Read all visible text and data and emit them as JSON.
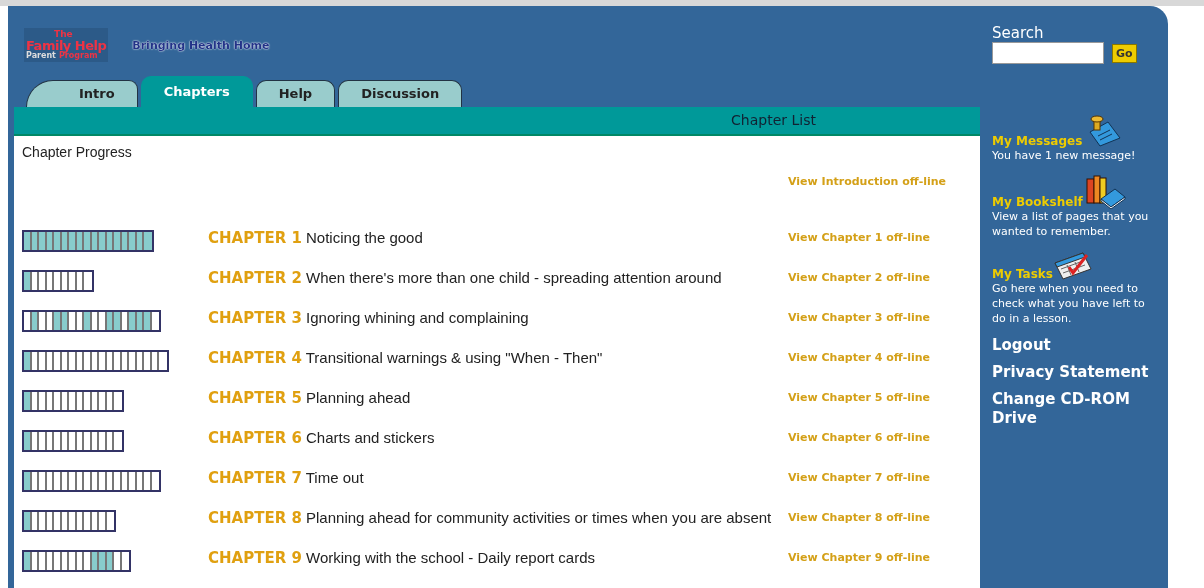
{
  "logo": {
    "top": "The",
    "main": "Family Help",
    "sub1": "Parent",
    "sub2": "Program"
  },
  "tagline": "Bringing Health Home",
  "tabs": [
    {
      "label": "Intro",
      "selected": false
    },
    {
      "label": "Chapters",
      "selected": true
    },
    {
      "label": "Help",
      "selected": false
    },
    {
      "label": "Discussion",
      "selected": false
    }
  ],
  "section_title": "Chapter List",
  "progress_heading": "Chapter Progress",
  "intro_link": "View Introduction off-line",
  "chapters": [
    {
      "number": "CHAPTER 1",
      "title": "Noticing the good",
      "link": "View Chapter 1 off-line",
      "segments": [
        true,
        true,
        true,
        true,
        true,
        true,
        true,
        true,
        true,
        true,
        true,
        true,
        true,
        true,
        true,
        true,
        true
      ]
    },
    {
      "number": "CHAPTER 2",
      "title": "When there's more than one child - spreading attention around",
      "link": "View Chapter 2 off-line",
      "segments": [
        true,
        false,
        false,
        false,
        false,
        false,
        false,
        false,
        false
      ]
    },
    {
      "number": "CHAPTER 3",
      "title": "Ignoring whining and complaining",
      "link": "View Chapter 3 off-line",
      "segments": [
        false,
        true,
        false,
        false,
        true,
        true,
        false,
        false,
        true,
        false,
        false,
        true,
        true,
        false,
        true,
        true,
        true,
        false
      ]
    },
    {
      "number": "CHAPTER 4",
      "title": "Transitional warnings & using \"When - Then\"",
      "link": "View Chapter 4 off-line",
      "segments": [
        true,
        false,
        false,
        false,
        false,
        false,
        false,
        false,
        false,
        false,
        false,
        false,
        false,
        false,
        false,
        false,
        false,
        false,
        false
      ]
    },
    {
      "number": "CHAPTER 5",
      "title": "Planning ahead",
      "link": "View Chapter 5 off-line",
      "segments": [
        true,
        false,
        false,
        false,
        false,
        false,
        false,
        false,
        false,
        false,
        false,
        false,
        false
      ]
    },
    {
      "number": "CHAPTER 6",
      "title": "Charts and stickers",
      "link": "View Chapter 6 off-line",
      "segments": [
        true,
        false,
        false,
        false,
        false,
        false,
        false,
        false,
        false,
        false,
        false,
        false,
        false
      ]
    },
    {
      "number": "CHAPTER 7",
      "title": "Time out",
      "link": "View Chapter 7 off-line",
      "segments": [
        true,
        false,
        false,
        false,
        false,
        false,
        false,
        false,
        false,
        false,
        false,
        false,
        false,
        false,
        false,
        false,
        false,
        false
      ]
    },
    {
      "number": "CHAPTER 8",
      "title": "Planning ahead for community activities or times when you are absent",
      "link": "View Chapter 8 off-line",
      "segments": [
        true,
        false,
        false,
        false,
        false,
        false,
        false,
        false,
        false,
        false,
        false,
        false
      ]
    },
    {
      "number": "CHAPTER 9",
      "title": "Working with the school - Daily report cards",
      "link": "View Chapter 9 off-line",
      "segments": [
        true,
        false,
        false,
        false,
        false,
        false,
        false,
        false,
        false,
        true,
        true,
        true,
        false,
        false
      ]
    }
  ],
  "search": {
    "label": "Search",
    "button": "Go"
  },
  "sidebar_items": [
    {
      "kind": "messages",
      "title": "My Messages",
      "description": "You have 1 new message!"
    },
    {
      "kind": "bookshelf",
      "title": "My Bookshelf",
      "description": "View a list of pages that you wanted to remember."
    },
    {
      "kind": "tasks",
      "title": "My Tasks",
      "description": "Go here when you need to check what you have left to do in a lesson."
    }
  ],
  "sidebar_links": [
    "Logout",
    "Privacy Statement",
    "Change CD-ROM Drive"
  ]
}
